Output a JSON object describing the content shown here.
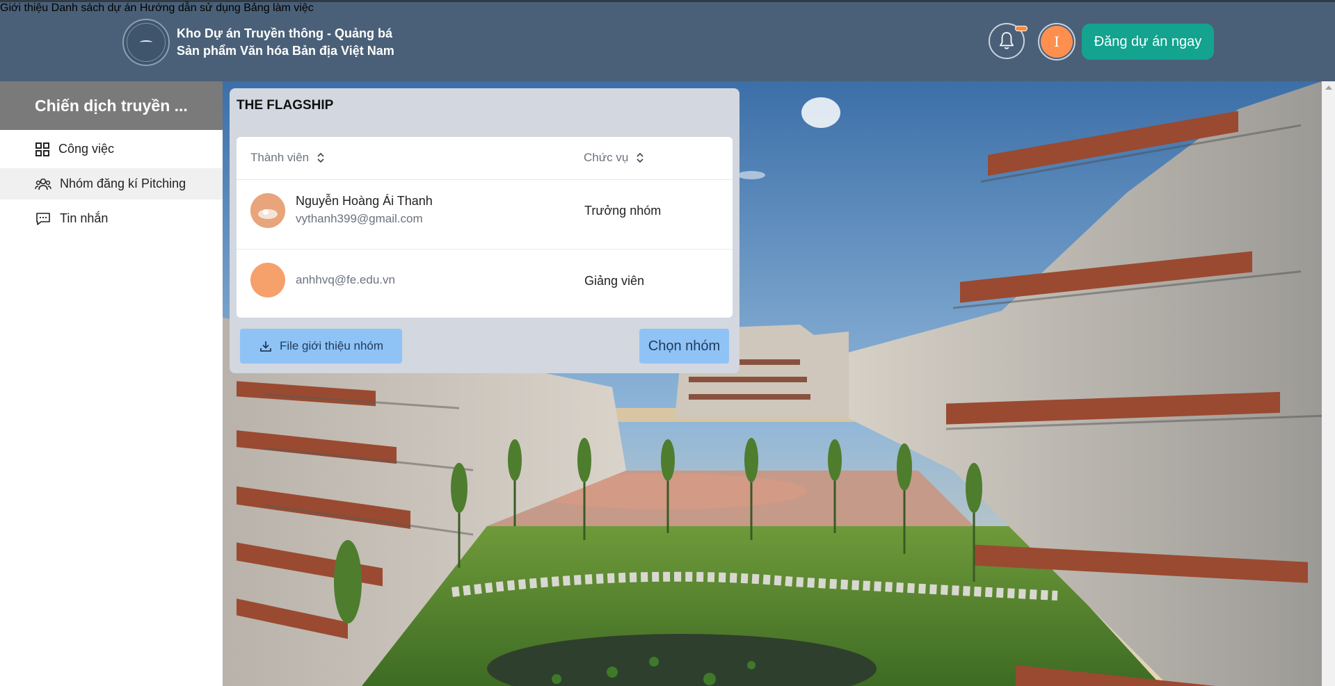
{
  "header": {
    "brand_line1": "Kho Dự án Truyền thông - Quảng bá",
    "brand_line2": "Sản phẩm Văn hóa Bản địa Việt Nam",
    "nav": [
      "Giới thiệu",
      "Danh sách dự án",
      "Hướng dẫn sử dụng",
      "Bảng làm việc"
    ],
    "avatar_initial": "I",
    "cta_label": "Đăng dự án ngay",
    "bell_icon": "bell-icon",
    "accent": "#13a38f",
    "header_bg": "#4a6078"
  },
  "sidebar": {
    "title": "Chiến dịch truyền ...",
    "items": [
      {
        "label": "Công việc",
        "icon": "grid-icon"
      },
      {
        "label": "Nhóm đăng kí Pitching",
        "icon": "users-icon",
        "active": true
      },
      {
        "label": "Tin nhắn",
        "icon": "chat-icon"
      }
    ]
  },
  "card": {
    "title": "THE FLAGSHIP",
    "columns": [
      "Thành viên",
      "Chức vụ"
    ],
    "rows": [
      {
        "name": "Nguyễn Hoàng Ái Thanh",
        "email": "vythanh399@gmail.com",
        "role": "Trưởng nhóm"
      },
      {
        "name": "",
        "email": "anhhvq@fe.edu.vn",
        "role": "Giảng viên"
      }
    ],
    "file_button": "File giới thiệu nhóm",
    "pick_button": "Chọn nhóm"
  }
}
